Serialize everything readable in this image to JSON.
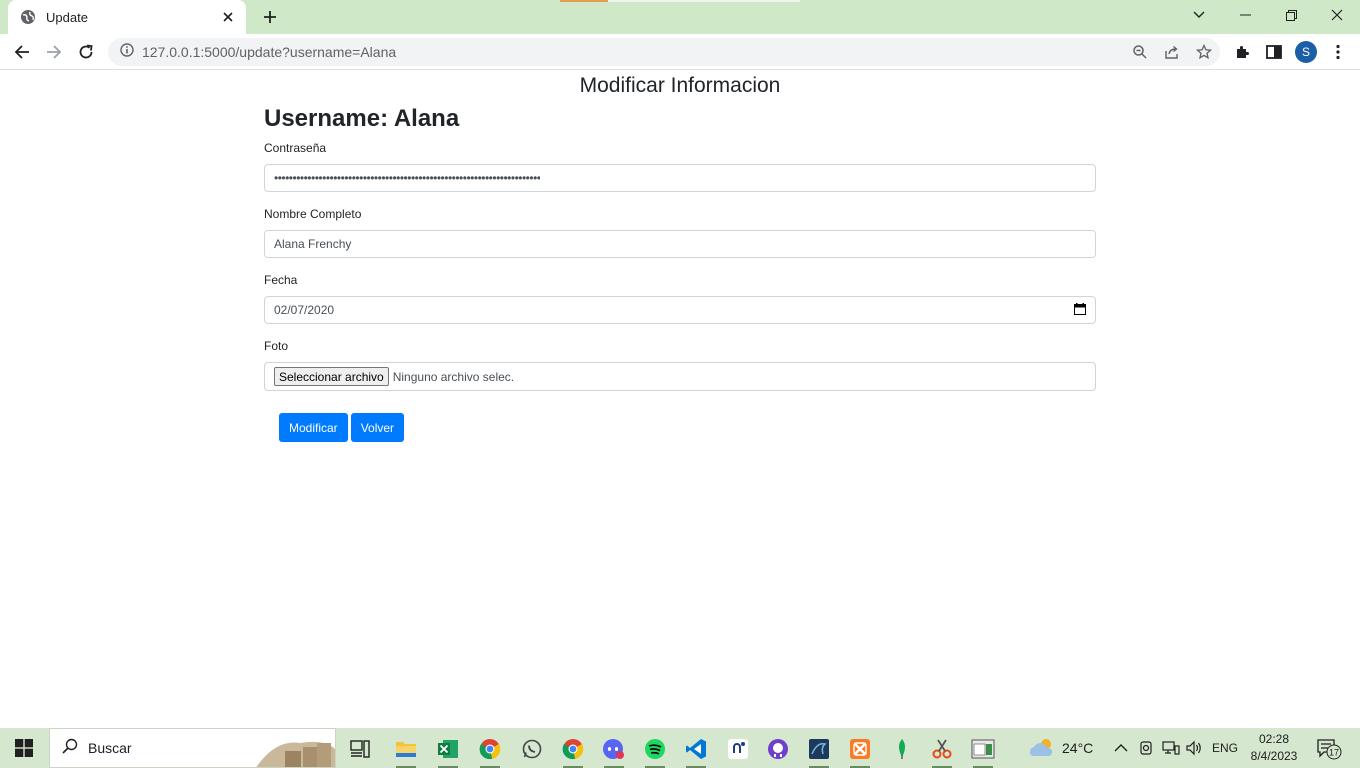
{
  "browser": {
    "tab_title": "Update",
    "url": "127.0.0.1:5000/update?username=Alana"
  },
  "page": {
    "title": "Modificar Informacion",
    "username_heading": "Username: Alana",
    "fields": {
      "password_label": "Contraseña",
      "password_value": "••••••••••••••••••••••••••••••••••••••••••••••••••••••••••••••••••••••••",
      "fullname_label": "Nombre Completo",
      "fullname_value": "Alana Frenchy",
      "date_label": "Fecha",
      "date_value": "02/07/2020",
      "photo_label": "Foto",
      "file_button": "Seleccionar archivo",
      "file_status": "Ninguno archivo selec."
    },
    "buttons": {
      "modify": "Modificar",
      "back": "Volver"
    }
  },
  "taskbar": {
    "search_placeholder": "Buscar",
    "weather": "24°C",
    "language": "ENG",
    "time": "02:28",
    "date": "8/4/2023",
    "notifications": "17"
  },
  "profile_initial": "S"
}
